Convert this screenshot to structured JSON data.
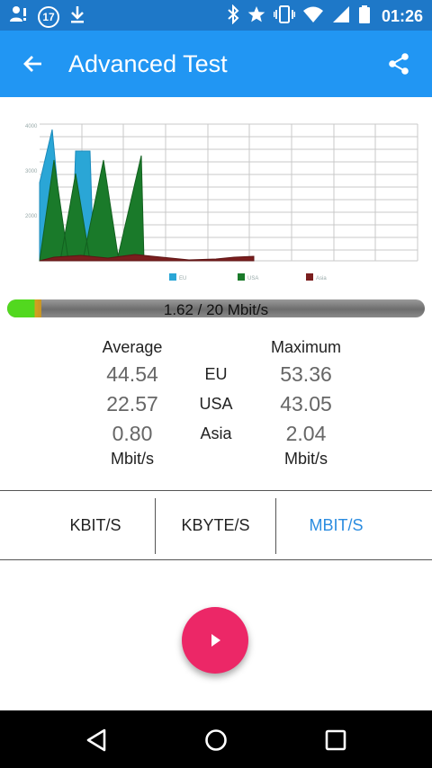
{
  "status_bar": {
    "time": "01:26",
    "notification_badge": "17",
    "icons_left": [
      "account-alert-icon",
      "badge-17-icon",
      "download-icon"
    ],
    "icons_right": [
      "bluetooth-icon",
      "star-icon",
      "vibrate-icon",
      "wifi-icon",
      "signal-icon",
      "battery-icon"
    ]
  },
  "app_bar": {
    "title": "Advanced Test",
    "back_icon": "arrow-left-icon",
    "share_icon": "share-icon"
  },
  "chart_data": {
    "type": "area",
    "series": [
      {
        "name": "EU",
        "color": "#2aa6d6"
      },
      {
        "name": "USA",
        "color": "#1a7a2a"
      },
      {
        "name": "Asia",
        "color": "#7a1e1e"
      }
    ],
    "grid": true,
    "legend": "bottom-center"
  },
  "progress": {
    "text": "1.62 / 20 Mbit/s",
    "fraction": 0.081
  },
  "stats": {
    "average_label": "Average",
    "maximum_label": "Maximum",
    "rows": [
      {
        "region": "EU",
        "average": "44.54",
        "maximum": "53.36"
      },
      {
        "region": "USA",
        "average": "22.57",
        "maximum": "43.05"
      },
      {
        "region": "Asia",
        "average": "0.80",
        "maximum": "2.04"
      }
    ],
    "unit_avg": "Mbit/s",
    "unit_max": "Mbit/s"
  },
  "unit_tabs": [
    {
      "label": "KBIT/S",
      "active": false
    },
    {
      "label": "KBYTE/S",
      "active": false
    },
    {
      "label": "MBIT/S",
      "active": true
    }
  ],
  "fab": {
    "icon": "play-icon"
  },
  "nav_bar": {
    "icons": [
      "back-triangle-icon",
      "home-circle-icon",
      "recents-square-icon"
    ]
  }
}
